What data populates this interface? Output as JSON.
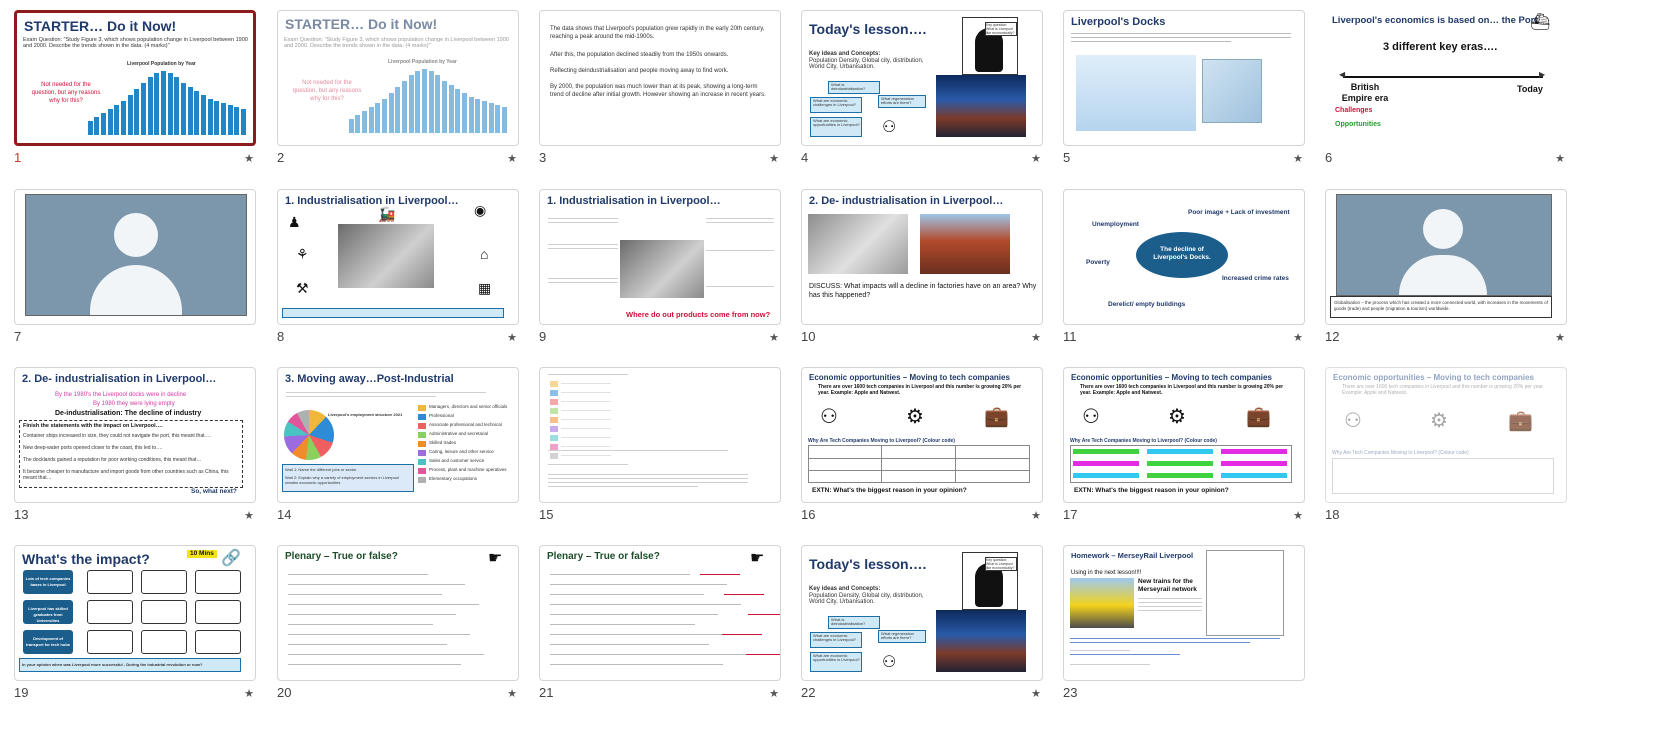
{
  "slides": [
    {
      "num": "1",
      "title": "STARTER… Do it Now!",
      "selected": true
    },
    {
      "num": "2",
      "title": "STARTER… Do it Now!"
    },
    {
      "num": "3",
      "title": ""
    },
    {
      "num": "4",
      "title": "Today's lesson…."
    },
    {
      "num": "5",
      "title": "Liverpool's Docks"
    },
    {
      "num": "6",
      "title": "Liverpool's economics is based on… the Port."
    },
    {
      "num": "7",
      "title": ""
    },
    {
      "num": "8",
      "title": "1. Industrialisation in Liverpool…"
    },
    {
      "num": "9",
      "title": "1. Industrialisation in Liverpool…"
    },
    {
      "num": "10",
      "title": "2. De- industrialisation in Liverpool…"
    },
    {
      "num": "11",
      "title": ""
    },
    {
      "num": "12",
      "title": ""
    },
    {
      "num": "13",
      "title": "2. De- industrialisation in Liverpool…"
    },
    {
      "num": "14",
      "title": "3. Moving away…Post-Industrial"
    },
    {
      "num": "15",
      "title": ""
    },
    {
      "num": "16",
      "title": "Economic opportunities – Moving to tech companies"
    },
    {
      "num": "17",
      "title": "Economic opportunities – Moving to tech companies"
    },
    {
      "num": "18",
      "title": "Economic opportunities – Moving to tech companies"
    },
    {
      "num": "19",
      "title": "What's the impact?"
    },
    {
      "num": "20",
      "title": "Plenary – True or false?"
    },
    {
      "num": "21",
      "title": "Plenary – True or false?"
    },
    {
      "num": "22",
      "title": "Today's lesson…."
    },
    {
      "num": "23",
      "title": "Homework – MerseyRail Liverpool"
    }
  ],
  "s1": {
    "exam": "Exam Question: \"Study Figure 3, which shows population change in Liverpool between 1900 and 2000. Describe the trends shown in the data. (4 marks)\"",
    "note": "Not needed for the question, but any reasons why for this?",
    "chart_title": "Liverpool Population by Year"
  },
  "s3": {
    "bullets": [
      "The data shows that Liverpool's population grew rapidly in the early 20th century, reaching a peak around the mid-1900s.",
      "After this, the population declined steadily from the 1950s onwards.",
      "Reflecting deindustrialisation and people moving away to find work.",
      "By 2000, the population was much lower than at its peak, showing a long-term trend of decline after initial growth. However showing an increase in recent years."
    ]
  },
  "s4": {
    "key_label": "Key ideas and Concepts:",
    "key_text": "Population Density, Global city, distribution, World City, Urbanisation.",
    "q1": "What is deindustrialisation?",
    "q2": "What are economic challenges in Liverpool?",
    "q3": "What regeneration efforts are there?",
    "q4": "What are economic opportunities in Liverpool?",
    "bubble": "Key question: What is Liverpool like economically?"
  },
  "s6": {
    "subtitle": "3 different key eras….",
    "left": "British Empire era",
    "right": "Today",
    "challenges": "Challenges",
    "opportunities": "Opportunities"
  },
  "s9": {
    "footer": "Where do out products come from now?"
  },
  "s10": {
    "discuss": "DISCUSS: What impacts will a decline in factories have on an area? Why has this happened?"
  },
  "s11": {
    "center": "The decline of Liverpool's Docks.",
    "items": [
      "Unemployment",
      "Poor image + Lack of investment",
      "Poverty",
      "Increased crime rates",
      "Derelict/ empty buildings"
    ]
  },
  "s12": {
    "caption": "Globalisation – the process which has created a more connected world, with increases in the movements of goods (trade) and people (migration & tourism) worldwide."
  },
  "s13": {
    "line1": "By the 1980's the Liverpool docks were in decline",
    "line2": "By 1980 they were lying empty",
    "sub": "De-industrialisation: The decline of industry",
    "task": "Finish the statements with the impact on Liverpool….",
    "items": [
      "Container ships increased in size, they could not navigate the port, this meant that….",
      "New deep-water ports opened closer to the coast, this led to….",
      "The docklands gained a reputation for poor working conditions, this meant that…",
      "It became cheaper to manufacture and import goods from other countries such as China, this meant that…"
    ],
    "next": "So, what next?"
  },
  "s14": {
    "legend": [
      "Managers, directors and senior officials",
      "Professional",
      "Associate professional and technical",
      "Administrative and secretarial",
      "Skilled trades",
      "Caring, leisure and other service",
      "Sales and customer service",
      "Process, plant and machine operatives",
      "Elementary occupations"
    ],
    "pie_title": "Liverpool's employment structure 2021",
    "wait1": "Wait 1: Name the different jobs or sector",
    "wait2": "Wait 2: Explain why a variety of employment sectors in Liverpool creates economic opportunities"
  },
  "s16": {
    "intro": "There are over 1600 tech companies in Liverpool and this number is growing 20% per year. Example: Apple and Natwest.",
    "why": "Why Are Tech Companies Moving to Liverpool? (Colour code)",
    "extn": "EXTN: What's the biggest reason in your opinion?"
  },
  "s19": {
    "mins": "10 Mins",
    "rows": [
      "Lots of tech companies bases in Liverpool",
      "Liverpool has skilled graduates from Universities",
      "Development of transport for tech hubs"
    ],
    "footer": "In your opinion when was Liverpool more successful - During the industrial revolution or now?"
  },
  "s23": {
    "sub": "Using in the next lesson!!!!",
    "headline": "New trains for the Merseyrail network"
  }
}
